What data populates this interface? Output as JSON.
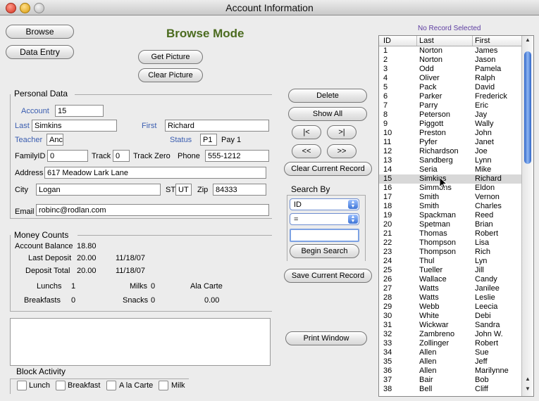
{
  "window": {
    "title": "Account Information"
  },
  "nav": {
    "browse": "Browse",
    "data_entry": "Data Entry"
  },
  "mode_title": "Browse Mode",
  "picture": {
    "get": "Get Picture",
    "clear": "Clear Picture"
  },
  "personal": {
    "section": "Personal Data",
    "account_label": "Account",
    "account": "15",
    "last_label": "Last",
    "last": "Simkins",
    "first_label": "First",
    "first": "Richard",
    "teacher_label": "Teacher",
    "teacher": "Anc",
    "status_label": "Status",
    "status": "P1",
    "pay": "Pay 1",
    "familyid_label": "FamilyID",
    "familyid": "0",
    "track_label": "Track",
    "track": "0",
    "track_zero": "Track Zero",
    "phone_label": "Phone",
    "phone": "555-1212",
    "address_label": "Address",
    "address": "617 Meadow Lark Lane",
    "city_label": "City",
    "city": "Logan",
    "st_label": "ST",
    "st": "UT",
    "zip_label": "Zip",
    "zip": "84333",
    "email_label": "Email",
    "email": "robinc@rodlan.com"
  },
  "money": {
    "section": "Money  Counts",
    "balance_label": "Account Balance",
    "balance": "18.80",
    "last_deposit_label": "Last Deposit",
    "last_deposit": "20.00",
    "last_deposit_date": "11/18/07",
    "deposit_total_label": "Deposit Total",
    "deposit_total": "20.00",
    "deposit_total_date": "11/18/07",
    "lunchs_label": "Lunchs",
    "lunchs": "1",
    "milks_label": "Milks",
    "milks": "0",
    "ala_carte_label": "Ala Carte",
    "breakfasts_label": "Breakfasts",
    "breakfasts": "0",
    "snacks_label": "Snacks",
    "snacks": "0",
    "ala_carte": "0.00"
  },
  "block": {
    "title": "Block Activity",
    "items": [
      "Lunch",
      "Breakfast",
      "A la Carte",
      "Milk"
    ]
  },
  "actions": {
    "delete": "Delete",
    "show_all": "Show All",
    "first": "|<",
    "last": ">|",
    "prev": "<<",
    "next": ">>",
    "clear_record": "Clear Current Record",
    "save_record": "Save Current Record",
    "print": "Print Window"
  },
  "search": {
    "title": "Search By",
    "field": "ID",
    "operator": "=",
    "value": "",
    "begin": "Begin Search"
  },
  "list": {
    "status": "No Record Selected",
    "columns": [
      "ID",
      "Last",
      "First"
    ],
    "rows": [
      [
        "1",
        "Norton",
        "James"
      ],
      [
        "2",
        "Norton",
        "Jason"
      ],
      [
        "3",
        "Odd",
        "Pamela"
      ],
      [
        "4",
        "Oliver",
        "Ralph"
      ],
      [
        "5",
        "Pack",
        "David"
      ],
      [
        "6",
        "Parker",
        "Frederick"
      ],
      [
        "7",
        "Parry",
        "Eric"
      ],
      [
        "8",
        "Peterson",
        "Jay"
      ],
      [
        "9",
        "Piggott",
        "Wally"
      ],
      [
        "10",
        "Preston",
        "John"
      ],
      [
        "11",
        "Pyfer",
        "Janet"
      ],
      [
        "12",
        "Richardson",
        "Joe"
      ],
      [
        "13",
        "Sandberg",
        "Lynn"
      ],
      [
        "14",
        "Seria",
        "Mike"
      ],
      [
        "15",
        "Simkins",
        "Richard"
      ],
      [
        "16",
        "Simmons",
        "Eldon"
      ],
      [
        "17",
        "Smith",
        "Vernon"
      ],
      [
        "18",
        "Smith",
        "Charles"
      ],
      [
        "19",
        "Spackman",
        "Reed"
      ],
      [
        "20",
        "Spetman",
        "Brian"
      ],
      [
        "21",
        "Thomas",
        "Robert"
      ],
      [
        "22",
        "Thompson",
        "Lisa"
      ],
      [
        "23",
        "Thompson",
        "Rich"
      ],
      [
        "24",
        "Thul",
        "Lyn"
      ],
      [
        "25",
        "Tueller",
        "Jill"
      ],
      [
        "26",
        "Wallace",
        "Candy"
      ],
      [
        "27",
        "Watts",
        "Janilee"
      ],
      [
        "28",
        "Watts",
        "Leslie"
      ],
      [
        "29",
        "Webb",
        "Leecia"
      ],
      [
        "30",
        "White",
        "Debi"
      ],
      [
        "31",
        "Wickwar",
        "Sandra"
      ],
      [
        "32",
        "Zambreno",
        "John W."
      ],
      [
        "33",
        "Zollinger",
        "Robert"
      ],
      [
        "34",
        "Allen",
        "Sue"
      ],
      [
        "35",
        "Allen",
        "Jeff"
      ],
      [
        "36",
        "Allen",
        "Marilynne"
      ],
      [
        "37",
        "Bair",
        "Bob"
      ],
      [
        "38",
        "Bell",
        "Cliff"
      ]
    ],
    "highlight_index": 14
  }
}
